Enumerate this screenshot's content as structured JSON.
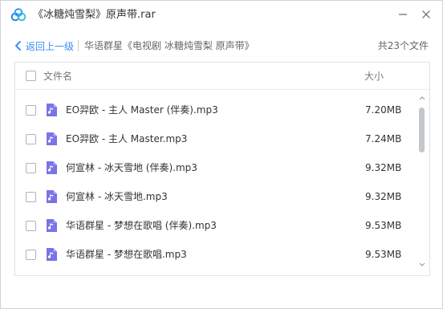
{
  "window": {
    "title": "《冰糖炖雪梨》原声带.rar"
  },
  "nav": {
    "back_label": "返回上一级",
    "breadcrumb": "华语群星《电视剧 冰糖炖雪梨 原声带》",
    "file_count": "共23个文件"
  },
  "table": {
    "col_name": "文件名",
    "col_size": "大小"
  },
  "files": [
    {
      "name": "EO羿欧 - 主人 Master (伴奏).mp3",
      "size": "7.20MB"
    },
    {
      "name": "EO羿欧 - 主人 Master.mp3",
      "size": "7.24MB"
    },
    {
      "name": "何宣林 - 冰天雪地 (伴奏).mp3",
      "size": "9.32MB"
    },
    {
      "name": "何宣林 - 冰天雪地.mp3",
      "size": "9.32MB"
    },
    {
      "name": "华语群星 - 梦想在歌唱 (伴奏).mp3",
      "size": "9.53MB"
    },
    {
      "name": "华语群星 - 梦想在歌唱.mp3",
      "size": "9.53MB"
    }
  ],
  "icons": {
    "app": "baidu-netdisk-logo",
    "file": "audio-file-icon",
    "back": "chevron-left-icon",
    "minimize": "minimize-icon",
    "close": "close-icon"
  },
  "colors": {
    "accent": "#3e8ff2",
    "file_icon": "#7a73e8"
  }
}
